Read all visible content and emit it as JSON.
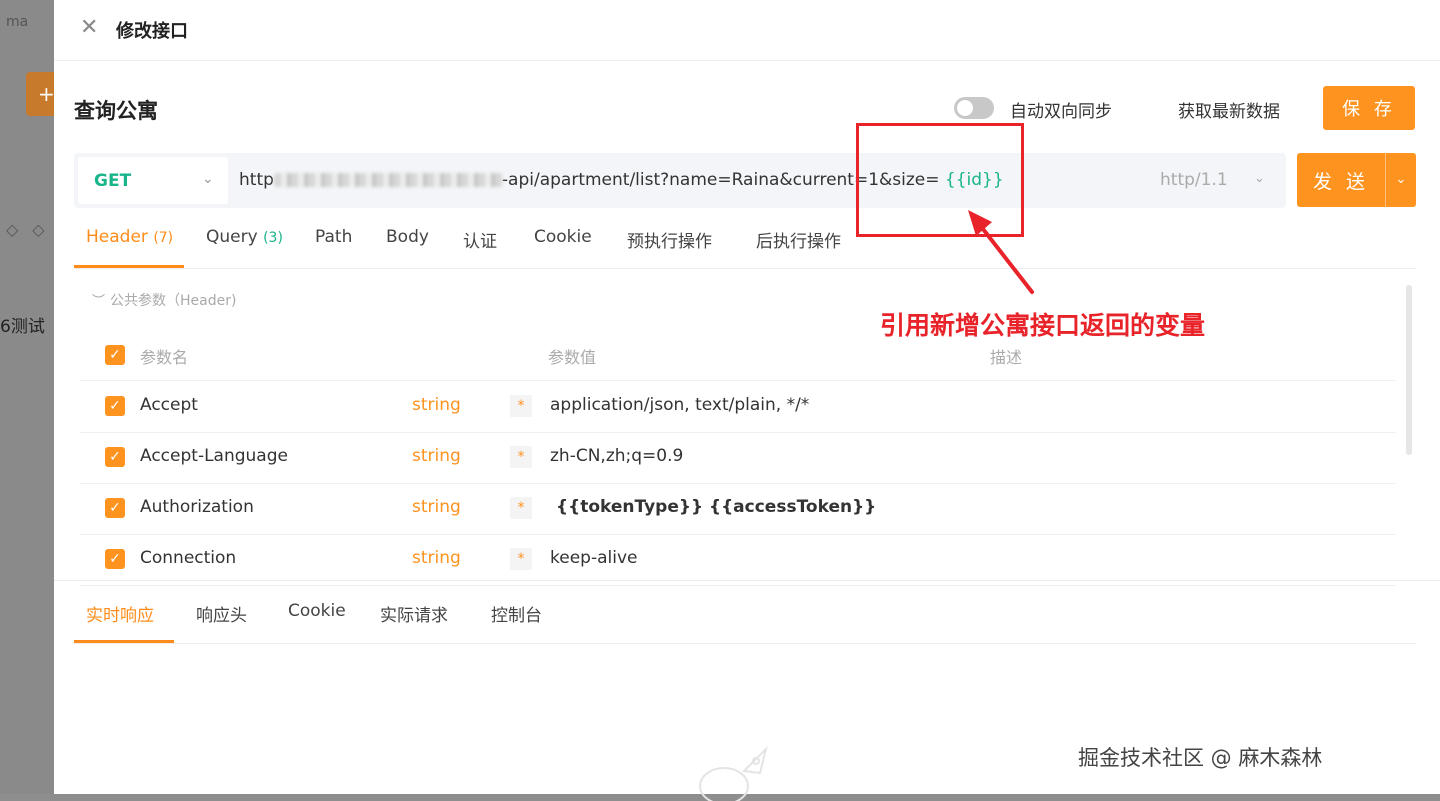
{
  "background": {
    "tab_label": "ma",
    "plus_label": "+",
    "icons": "◇◇",
    "side_text": "6测试"
  },
  "drawer": {
    "title": "修改接口",
    "api_name": "查询公寓",
    "sync_label": "自动双向同步",
    "sync_enabled": false,
    "fetch_label": "获取最新数据",
    "save_label": "保 存"
  },
  "request": {
    "method": "GET",
    "url_prefix": "http",
    "url_suffix": "-api/apartment/list?name=Raina&current=1&size= ",
    "url_variable": "{{id}}",
    "http_version": "http/1.1",
    "send_label": "发 送"
  },
  "tabs": [
    {
      "label": "Header",
      "count": "(7)"
    },
    {
      "label": "Query",
      "count": "(3)"
    },
    {
      "label": "Path",
      "count": ""
    },
    {
      "label": "Body",
      "count": ""
    },
    {
      "label": "认证",
      "count": ""
    },
    {
      "label": "Cookie",
      "count": ""
    },
    {
      "label": "预执行操作",
      "count": ""
    },
    {
      "label": "后执行操作",
      "count": ""
    }
  ],
  "public_params_label": "公共参数（Header)",
  "table": {
    "headers": {
      "name": "参数名",
      "value": "参数值",
      "desc": "描述"
    },
    "rows": [
      {
        "name": "Accept",
        "type": "string",
        "required": "*",
        "value": "application/json, text/plain, */*"
      },
      {
        "name": "Accept-Language",
        "type": "string",
        "required": "*",
        "value": "zh-CN,zh;q=0.9"
      },
      {
        "name": "Authorization",
        "type": "string",
        "required": "*",
        "value": "{{tokenType}}  {{accessToken}}"
      },
      {
        "name": "Connection",
        "type": "string",
        "required": "*",
        "value": "keep-alive"
      }
    ]
  },
  "response_tabs": [
    "实时响应",
    "响应头",
    "Cookie",
    "实际请求",
    "控制台"
  ],
  "annotation": {
    "text": "引用新增公寓接口返回的变量",
    "color": "#e8232a"
  },
  "watermark": "掘金技术社区 @ 麻木森林",
  "colors": {
    "accent": "#ff9320",
    "variable": "#19b48a"
  }
}
